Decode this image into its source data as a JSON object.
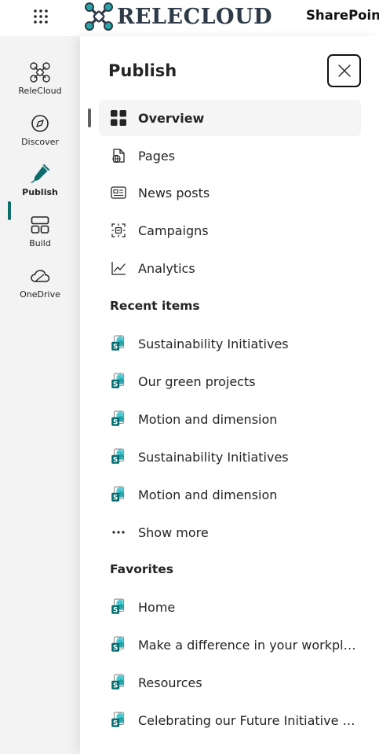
{
  "header": {
    "brand_name": "RELECLOUD",
    "app_name": "SharePoint"
  },
  "rail": {
    "items": [
      {
        "label": "ReleCloud",
        "icon": "relecloud-icon"
      },
      {
        "label": "Discover",
        "icon": "compass-icon"
      },
      {
        "label": "Publish",
        "icon": "pen-icon",
        "active": true
      },
      {
        "label": "Build",
        "icon": "layout-icon"
      },
      {
        "label": "OneDrive",
        "icon": "cloud-icon"
      }
    ]
  },
  "panel": {
    "title": "Publish",
    "nav": [
      {
        "label": "Overview",
        "icon": "grid-icon",
        "selected": true
      },
      {
        "label": "Pages",
        "icon": "page-globe-icon"
      },
      {
        "label": "News posts",
        "icon": "news-icon"
      },
      {
        "label": "Campaigns",
        "icon": "campaign-icon"
      },
      {
        "label": "Analytics",
        "icon": "chart-line-icon"
      }
    ],
    "recent_heading": "Recent items",
    "recent": [
      {
        "label": "Sustainability Initiatives",
        "icon": "sharepoint-site-icon"
      },
      {
        "label": "Our green projects",
        "icon": "sharepoint-site-icon"
      },
      {
        "label": "Motion and dimension",
        "icon": "sharepoint-site-icon"
      },
      {
        "label": "Sustainability Initiatives",
        "icon": "sharepoint-site-icon"
      },
      {
        "label": "Motion and dimension",
        "icon": "sharepoint-site-icon"
      }
    ],
    "show_more": "Show more",
    "favorites_heading": "Favorites",
    "favorites": [
      {
        "label": "Home",
        "icon": "sharepoint-site-icon"
      },
      {
        "label": "Make a difference in your workplace",
        "icon": "sharepoint-site-icon"
      },
      {
        "label": "Resources",
        "icon": "sharepoint-site-icon"
      },
      {
        "label": "Celebrating our Future Initiative pro...",
        "icon": "sharepoint-site-icon"
      }
    ]
  },
  "colors": {
    "accent": "#0f6c6c",
    "brand_text": "#2e3a47",
    "rail_bg": "#f3f3f3"
  }
}
